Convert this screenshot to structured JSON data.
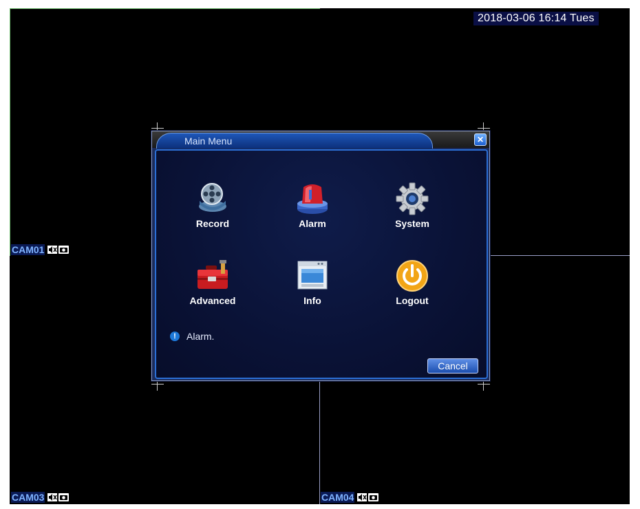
{
  "clock": "2018-03-06 16:14 Tues",
  "cameras": [
    {
      "name": "CAM01"
    },
    {
      "name": "CAM03"
    },
    {
      "name": "CAM04"
    }
  ],
  "dialog": {
    "title": "Main Menu",
    "close_icon": "close-icon",
    "items": [
      {
        "label": "Record",
        "icon": "record-film-icon"
      },
      {
        "label": "Alarm",
        "icon": "alarm-siren-icon"
      },
      {
        "label": "System",
        "icon": "gear-icon"
      },
      {
        "label": "Advanced",
        "icon": "toolbox-icon"
      },
      {
        "label": "Info",
        "icon": "info-window-icon"
      },
      {
        "label": "Logout",
        "icon": "power-icon"
      }
    ],
    "status_text": "Alarm.",
    "cancel_label": "Cancel"
  },
  "colors": {
    "accent": "#2b6fd6",
    "panel": "#0a1236",
    "cam_label": "#7fb3ff"
  }
}
